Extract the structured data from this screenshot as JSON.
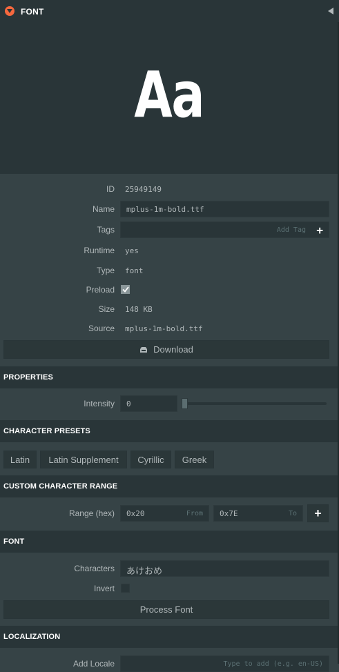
{
  "header": {
    "title": "FONT"
  },
  "preview": {
    "sample": "Aa"
  },
  "asset": {
    "id_label": "ID",
    "id_value": "25949149",
    "name_label": "Name",
    "name_value": "mplus-1m-bold.ttf",
    "tags_label": "Tags",
    "tags_placeholder": "Add Tag",
    "runtime_label": "Runtime",
    "runtime_value": "yes",
    "type_label": "Type",
    "type_value": "font",
    "preload_label": "Preload",
    "preload_checked": true,
    "size_label": "Size",
    "size_value": "148 KB",
    "source_label": "Source",
    "source_value": "mplus-1m-bold.ttf",
    "download_label": "Download"
  },
  "properties": {
    "title": "PROPERTIES",
    "intensity_label": "Intensity",
    "intensity_value": "0",
    "intensity_level": 0
  },
  "presets": {
    "title": "CHARACTER PRESETS",
    "buttons": [
      "Latin",
      "Latin Supplement",
      "Cyrillic",
      "Greek"
    ]
  },
  "custom_range": {
    "title": "CUSTOM CHARACTER RANGE",
    "range_label": "Range (hex)",
    "from_value": "0x20",
    "from_placeholder": "From",
    "to_value": "0x7E",
    "to_placeholder": "To",
    "add_symbol": "+"
  },
  "font_section": {
    "title": "FONT",
    "characters_label": "Characters",
    "characters_value": "あけおめ",
    "invert_label": "Invert",
    "invert_checked": false,
    "process_label": "Process Font"
  },
  "localization": {
    "title": "LOCALIZATION",
    "add_locale_label": "Add Locale",
    "add_locale_placeholder": "Type to add (e.g. en-US)"
  },
  "colors": {
    "accent": "#f6683e",
    "panel": "#364346",
    "header": "#293538"
  }
}
